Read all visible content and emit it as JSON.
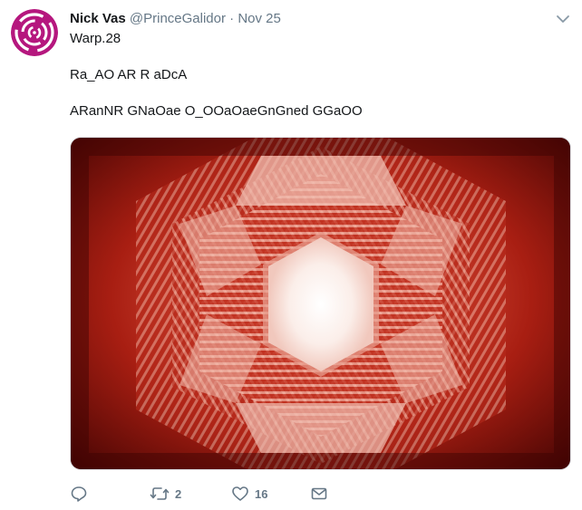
{
  "tweet": {
    "display_name": "Nick Vas",
    "handle": "@PrinceGalidor",
    "separator": "·",
    "date": "Nov 25",
    "lines": [
      "Warp.28",
      "Ra_AO AR R aDcA",
      "ARanNR GNaOae O_OOaOaeGnGned GGaOO"
    ],
    "actions": {
      "reply_icon": "reply-icon",
      "retweet_icon": "retweet-icon",
      "retweet_count": "2",
      "like_icon": "heart-icon",
      "like_count": "16",
      "message_icon": "envelope-icon"
    },
    "colors": {
      "avatar": "#b5177e",
      "muted": "#657786",
      "media_red": "#c0301f"
    }
  }
}
